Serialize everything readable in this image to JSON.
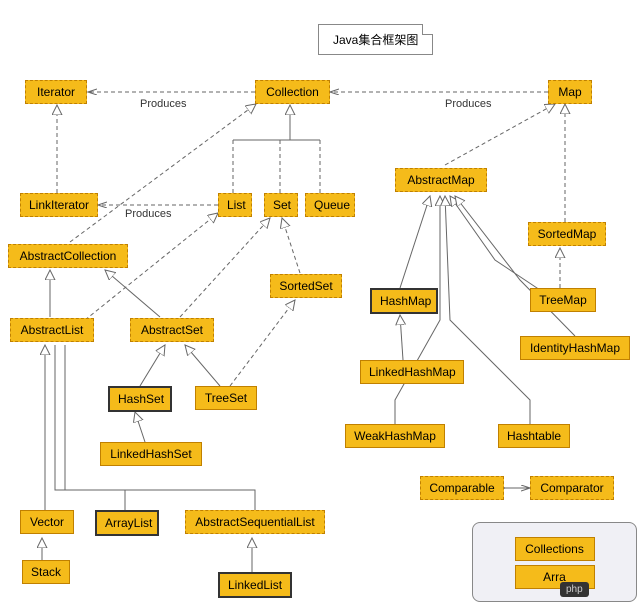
{
  "title": "Java集合框架图",
  "labels": {
    "produces1": "Produces",
    "produces2": "Produces",
    "produces3": "Produces"
  },
  "nodes": {
    "iterator": "Iterator",
    "collection": "Collection",
    "map": "Map",
    "linkIterator": "LinkIterator",
    "list": "List",
    "set": "Set",
    "queue": "Queue",
    "abstractMap": "AbstractMap",
    "sortedMap": "SortedMap",
    "abstractCollection": "AbstractCollection",
    "sortedSet": "SortedSet",
    "hashMap": "HashMap",
    "treeMap": "TreeMap",
    "abstractList": "AbstractList",
    "abstractSet": "AbstractSet",
    "identityHashMap": "IdentityHashMap",
    "linkedHashMap": "LinkedHashMap",
    "hashSet": "HashSet",
    "treeSet": "TreeSet",
    "weakHashMap": "WeakHashMap",
    "hashtable": "Hashtable",
    "linkedHashSet": "LinkedHashSet",
    "comparable": "Comparable",
    "comparator": "Comparator",
    "vector": "Vector",
    "arrayList": "ArrayList",
    "abstractSequentialList": "AbstractSequentialList",
    "stack": "Stack",
    "linkedList": "LinkedList",
    "collections": "Collections",
    "arrays": "Arra"
  },
  "watermark": "php"
}
